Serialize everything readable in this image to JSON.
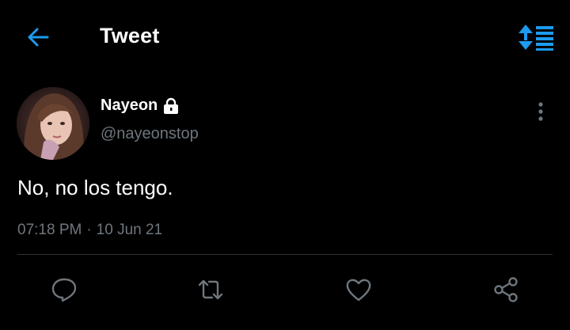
{
  "header": {
    "title": "Tweet",
    "back_icon": "arrow-left-icon",
    "sort_icon": "sort-lines-icon",
    "accent_color": "#1d9bf0"
  },
  "tweet": {
    "author_name": "Nayeon",
    "author_handle": "@nayeonstop",
    "protected_icon": "lock-icon",
    "text": "No, no los tengo.",
    "time": "07:18 PM",
    "separator": "·",
    "date": "10 Jun 21"
  },
  "actions": {
    "reply_icon": "reply-bubble-icon",
    "retweet_icon": "retweet-icon",
    "like_icon": "heart-icon",
    "share_icon": "share-icon",
    "icon_color": "#6e767d"
  },
  "colors": {
    "background": "#000000",
    "text_primary": "#ffffff",
    "text_secondary": "#6e767d",
    "divider": "#2f3336"
  }
}
